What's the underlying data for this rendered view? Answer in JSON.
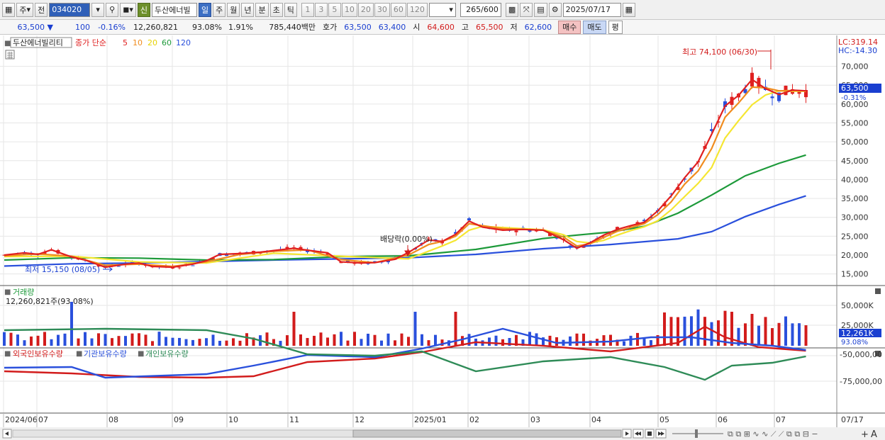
{
  "toolbar": {
    "market": "주",
    "prev_label": "전",
    "stock_code": "034020",
    "shin_label": "신",
    "stock_name": "두산에너빌",
    "period_tabs": [
      "일",
      "주",
      "월",
      "년",
      "분",
      "초",
      "틱"
    ],
    "period_numbers": [
      "1",
      "3",
      "5",
      "10",
      "20",
      "30",
      "60",
      "120"
    ],
    "count": "265",
    "count_total": "/600",
    "date": "2025/07/17"
  },
  "quote": {
    "price": "63,500",
    "change": "100",
    "change_pct": "-0.16%",
    "volume": "12,260,821",
    "vol_ratio": "93.08%",
    "turnover": "1.91%",
    "amount": "785,440백만",
    "bid_label": "호가",
    "ask": "63,500",
    "bid": "63,400",
    "open_label": "시",
    "open": "64,600",
    "high_label": "고",
    "high": "65,500",
    "low_label": "저",
    "low": "62,600",
    "buy_label": "매수",
    "sell_label": "매도",
    "eval_label": "평"
  },
  "price_panel": {
    "title": "두산에너빌리티",
    "ma_label": "종가 단순",
    "ma_periods": [
      "5",
      "10",
      "20",
      "60",
      "120"
    ],
    "lc": "LC:319.14",
    "hc": "HC:-14.30",
    "current_price": "63,500",
    "current_pct": "-0.31%",
    "high_annotation": "최고 74,100 (06/30)",
    "low_annotation": "최저 15,150 (08/05)",
    "dividend_annotation": "배당락(0.00%)",
    "axis_labels": [
      "70,000",
      "65,000",
      "60,000",
      "55,000",
      "50,000",
      "45,000",
      "40,000",
      "35,000",
      "30,000",
      "25,000",
      "20,000",
      "15,000"
    ]
  },
  "volume_panel": {
    "title": "거래량",
    "info": "12,260,821주(93.08%)",
    "axis_labels": [
      "50,000K",
      "25,000K"
    ],
    "current": "12,261K",
    "current_pct": "93.08%"
  },
  "holding_panel": {
    "legend": [
      "외국인보유수량",
      "기관보유수량",
      "개인보유수량"
    ],
    "axis_labels": [
      "-50,000,00",
      "-75,000,00"
    ]
  },
  "x_axis": {
    "labels": [
      "2024/06",
      "07",
      "08",
      "09",
      "10",
      "11",
      "12",
      "2025/01",
      "02",
      "03",
      "04",
      "05",
      "06",
      "07"
    ],
    "end_label": "07/17"
  },
  "chart_data": {
    "type": "line",
    "title": "두산에너빌리티",
    "series": [
      {
        "name": "5",
        "color": "#e02020",
        "values": [
          [
            0,
            20000
          ],
          [
            3,
            20600
          ],
          [
            5,
            20200
          ],
          [
            7,
            21400
          ],
          [
            10,
            19500
          ],
          [
            12,
            18700
          ],
          [
            15,
            16800
          ],
          [
            18,
            17600
          ],
          [
            20,
            17900
          ],
          [
            22,
            17000
          ],
          [
            25,
            16800
          ],
          [
            28,
            17600
          ],
          [
            30,
            18500
          ],
          [
            32,
            20200
          ],
          [
            35,
            20400
          ],
          [
            38,
            20800
          ],
          [
            40,
            21200
          ],
          [
            43,
            21800
          ],
          [
            45,
            21300
          ],
          [
            48,
            20600
          ],
          [
            50,
            18200
          ],
          [
            53,
            17900
          ],
          [
            55,
            18000
          ],
          [
            58,
            18900
          ],
          [
            60,
            20700
          ],
          [
            63,
            24000
          ],
          [
            65,
            23600
          ],
          [
            67,
            25500
          ],
          [
            69,
            29000
          ],
          [
            71,
            27400
          ],
          [
            74,
            26600
          ],
          [
            77,
            26800
          ],
          [
            80,
            26600
          ],
          [
            83,
            24100
          ],
          [
            85,
            21800
          ],
          [
            87,
            23300
          ],
          [
            89,
            25300
          ],
          [
            91,
            26800
          ],
          [
            93,
            27800
          ],
          [
            95,
            28700
          ],
          [
            97,
            31700
          ],
          [
            99,
            35700
          ],
          [
            101,
            40500
          ],
          [
            103,
            44700
          ],
          [
            105,
            52000
          ],
          [
            107,
            59500
          ],
          [
            109,
            62300
          ],
          [
            111,
            66500
          ],
          [
            113,
            64100
          ],
          [
            115,
            62500
          ],
          [
            117,
            63700
          ],
          [
            119,
            63500
          ]
        ]
      },
      {
        "name": "10",
        "color": "#f08c1e",
        "values": [
          [
            0,
            19800
          ],
          [
            5,
            20300
          ],
          [
            10,
            19700
          ],
          [
            15,
            17300
          ],
          [
            20,
            17600
          ],
          [
            25,
            17000
          ],
          [
            30,
            18200
          ],
          [
            35,
            20200
          ],
          [
            40,
            21000
          ],
          [
            45,
            21400
          ],
          [
            50,
            18800
          ],
          [
            55,
            18000
          ],
          [
            60,
            20000
          ],
          [
            63,
            22800
          ],
          [
            65,
            23600
          ],
          [
            67,
            25000
          ],
          [
            69,
            28300
          ],
          [
            71,
            27800
          ],
          [
            74,
            27000
          ],
          [
            77,
            26800
          ],
          [
            80,
            26600
          ],
          [
            83,
            24800
          ],
          [
            85,
            22400
          ],
          [
            87,
            23000
          ],
          [
            89,
            24700
          ],
          [
            91,
            26300
          ],
          [
            93,
            27300
          ],
          [
            95,
            28300
          ],
          [
            97,
            30700
          ],
          [
            99,
            34100
          ],
          [
            101,
            38800
          ],
          [
            103,
            42300
          ],
          [
            105,
            48200
          ],
          [
            107,
            56500
          ],
          [
            109,
            60300
          ],
          [
            111,
            64500
          ],
          [
            113,
            64300
          ],
          [
            115,
            63500
          ],
          [
            117,
            63600
          ],
          [
            119,
            63500
          ]
        ]
      },
      {
        "name": "20",
        "color": "#f5e632",
        "values": [
          [
            0,
            19600
          ],
          [
            10,
            19700
          ],
          [
            20,
            18200
          ],
          [
            30,
            17900
          ],
          [
            40,
            20500
          ],
          [
            50,
            19700
          ],
          [
            60,
            19000
          ],
          [
            65,
            22400
          ],
          [
            67,
            23900
          ],
          [
            69,
            26600
          ],
          [
            71,
            27600
          ],
          [
            74,
            27300
          ],
          [
            77,
            27000
          ],
          [
            80,
            26700
          ],
          [
            83,
            25400
          ],
          [
            85,
            23600
          ],
          [
            87,
            23200
          ],
          [
            89,
            23900
          ],
          [
            91,
            25300
          ],
          [
            93,
            26500
          ],
          [
            95,
            27500
          ],
          [
            97,
            29100
          ],
          [
            99,
            32000
          ],
          [
            101,
            35500
          ],
          [
            103,
            39000
          ],
          [
            105,
            43200
          ],
          [
            107,
            51000
          ],
          [
            109,
            55600
          ],
          [
            111,
            59800
          ],
          [
            113,
            62400
          ],
          [
            115,
            63500
          ],
          [
            117,
            63400
          ],
          [
            119,
            63400
          ]
        ]
      },
      {
        "name": "60",
        "color": "#1d9a3a",
        "values": [
          [
            0,
            18700
          ],
          [
            10,
            19300
          ],
          [
            20,
            19200
          ],
          [
            30,
            18700
          ],
          [
            40,
            18800
          ],
          [
            50,
            19600
          ],
          [
            60,
            19800
          ],
          [
            70,
            21500
          ],
          [
            80,
            24400
          ],
          [
            85,
            25300
          ],
          [
            90,
            26100
          ],
          [
            95,
            27600
          ],
          [
            100,
            31100
          ],
          [
            105,
            35900
          ],
          [
            110,
            41000
          ],
          [
            115,
            44300
          ],
          [
            119,
            46500
          ]
        ]
      },
      {
        "name": "120",
        "color": "#2a50dc",
        "values": [
          [
            0,
            17100
          ],
          [
            10,
            17700
          ],
          [
            20,
            17900
          ],
          [
            30,
            18300
          ],
          [
            40,
            18700
          ],
          [
            50,
            19000
          ],
          [
            60,
            19300
          ],
          [
            70,
            20200
          ],
          [
            80,
            21700
          ],
          [
            90,
            22800
          ],
          [
            100,
            24300
          ],
          [
            105,
            26200
          ],
          [
            110,
            30200
          ],
          [
            115,
            33400
          ],
          [
            119,
            35700
          ]
        ]
      }
    ],
    "ylim": [
      12500,
      74800
    ]
  }
}
